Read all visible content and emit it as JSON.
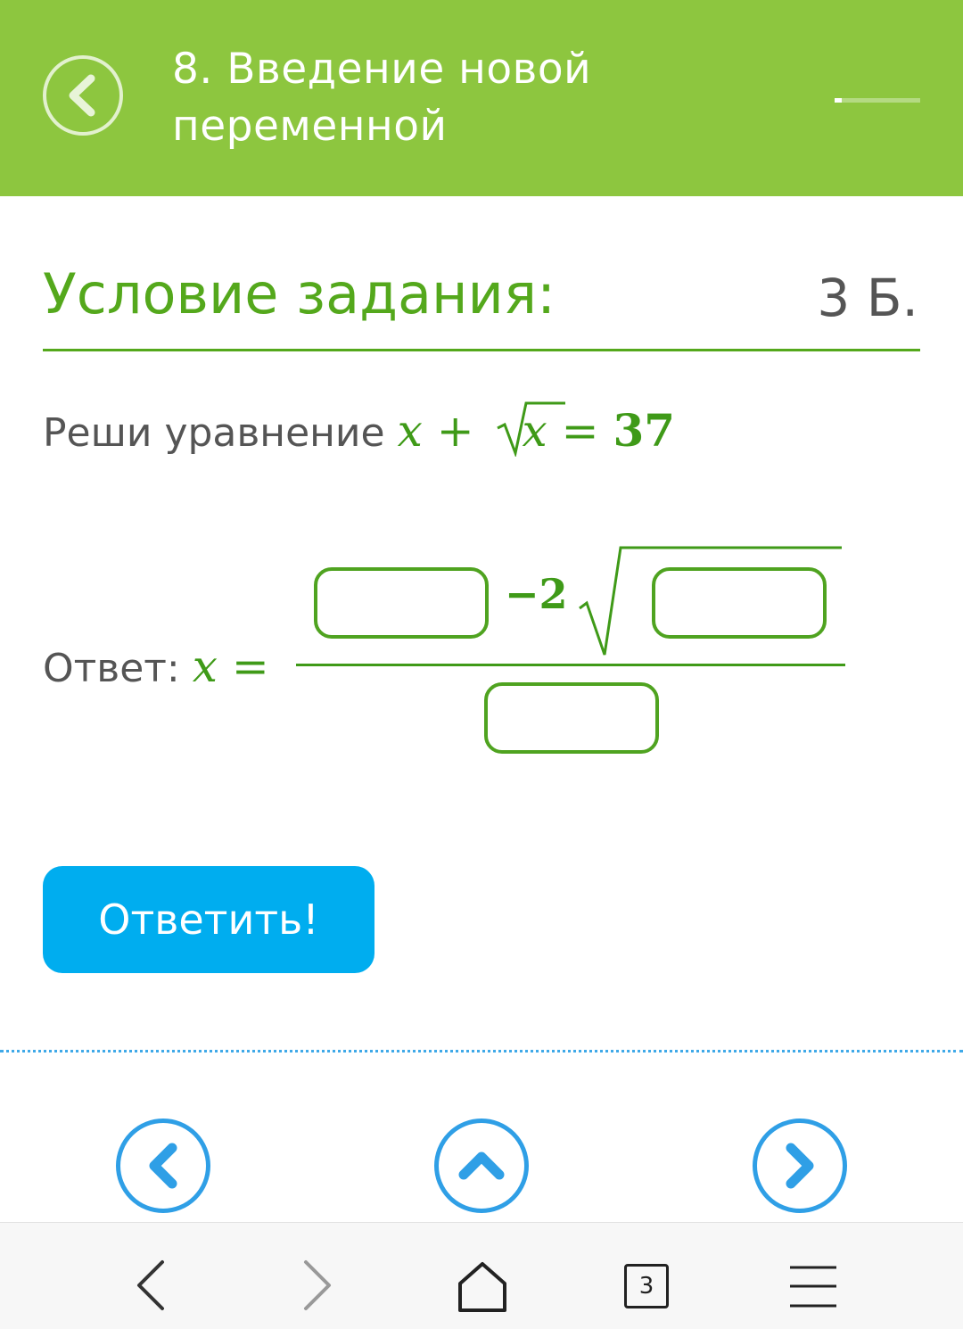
{
  "header": {
    "title": "8. Введение новой переменной",
    "progress_fraction": 0.08,
    "back_icon": "chevron-left-icon"
  },
  "condition": {
    "title": "Условие задания:",
    "points": "3 Б."
  },
  "task": {
    "text": "Реши уравнение",
    "equation": {
      "x": "x",
      "plus": "+",
      "sqrt_arg": "x",
      "equals": "=",
      "rhs": "37"
    }
  },
  "answer": {
    "label": "Ответ:",
    "var": "x",
    "equals": "=",
    "numerator_mid": "−2",
    "inputs": {
      "numerator_left": "",
      "under_root": "",
      "denominator": ""
    }
  },
  "submit_label": "Ответить!",
  "nav": {
    "prev_icon": "chevron-left-icon",
    "up_icon": "chevron-up-icon",
    "next_icon": "chevron-right-icon"
  },
  "browser": {
    "tab_count": "3",
    "icons": [
      "back-arrow-icon",
      "forward-arrow-icon",
      "home-icon",
      "tabs-icon",
      "menu-icon"
    ]
  },
  "colors": {
    "header_green": "#8dc63f",
    "accent_green": "#54a81c",
    "button_blue": "#00adef",
    "nav_blue": "#2f9fe6"
  }
}
